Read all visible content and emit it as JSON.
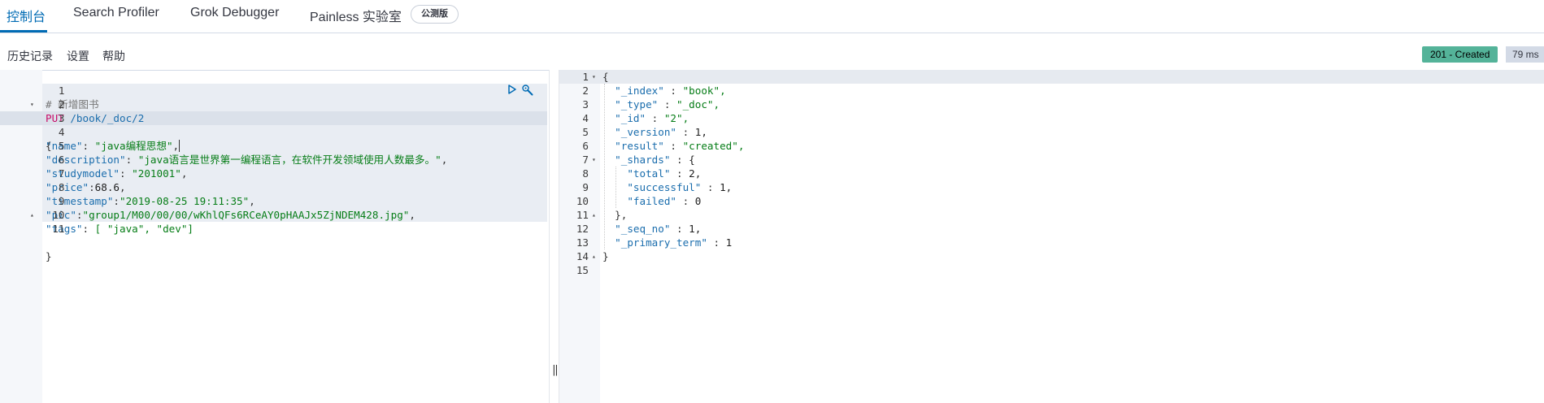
{
  "tabs": [
    {
      "label": "控制台",
      "active": true
    },
    {
      "label": "Search Profiler",
      "active": false
    },
    {
      "label": "Grok Debugger",
      "active": false
    },
    {
      "label": "Painless 实验室",
      "active": false
    }
  ],
  "beta_badge": "公测版",
  "toolbar": {
    "history": "历史记录",
    "settings": "设置",
    "help": "帮助"
  },
  "response_status": {
    "status": "201 - Created",
    "time": "79 ms",
    "status_color": "#54b399"
  },
  "request": {
    "comment": "# 新增图书",
    "method": "PUT",
    "path": "/book/_doc/2",
    "body_open": "{",
    "fields": [
      {
        "key": "\"name\"",
        "sep": ": ",
        "value": "\"java编程思想\"",
        "tail": ","
      },
      {
        "key": "\"description\"",
        "sep": ": ",
        "value": "\"java语言是世界第一编程语言，在软件开发领域使用人数最多。\"",
        "tail": ","
      },
      {
        "key": "\"studymodel\"",
        "sep": ": ",
        "value": "\"201001\"",
        "tail": ","
      },
      {
        "key": "\"price\"",
        "sep": ":",
        "value": "68.6",
        "tail": ","
      },
      {
        "key": "\"timestamp\"",
        "sep": ":",
        "value": "\"2019-08-25 19:11:35\"",
        "tail": ","
      },
      {
        "key": "\"pic\"",
        "sep": ":",
        "value": "\"group1/M00/00/00/wKhlQFs6RCeAY0pHAAJx5ZjNDEM428.jpg\"",
        "tail": ","
      },
      {
        "key": "\"tags\"",
        "sep": ": ",
        "value": "[ \"java\", \"dev\"]",
        "tail": ""
      }
    ],
    "body_close": "}",
    "line_numbers": [
      "1",
      "2",
      "3",
      "4",
      "5",
      "6",
      "7",
      "8",
      "9",
      "10",
      "11"
    ]
  },
  "response": {
    "lines": [
      "{",
      "  \"_index\" : \"book\",",
      "  \"_type\" : \"_doc\",",
      "  \"_id\" : \"2\",",
      "  \"_version\" : 1,",
      "  \"result\" : \"created\",",
      "  \"_shards\" : {",
      "    \"total\" : 2,",
      "    \"successful\" : 1,",
      "    \"failed\" : 0",
      "  },",
      "  \"_seq_no\" : 1,",
      "  \"_primary_term\" : 1",
      "}",
      ""
    ],
    "line_numbers": [
      "1",
      "2",
      "3",
      "4",
      "5",
      "6",
      "7",
      "8",
      "9",
      "10",
      "11",
      "12",
      "13",
      "14",
      "15"
    ]
  },
  "icons": {
    "run": "play-icon",
    "settings": "wrench-icon",
    "resize": "vertical-resize-handle"
  },
  "splitter_glyph": "‖"
}
